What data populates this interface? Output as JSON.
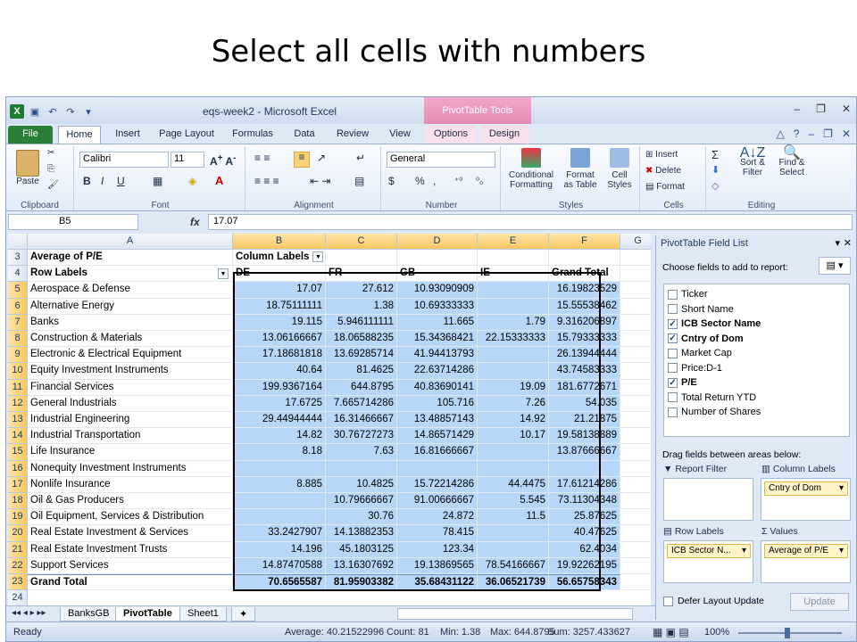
{
  "slide_title": "Select all cells with numbers",
  "window": {
    "title": "eqs-week2 - Microsoft Excel",
    "contextual_tab_group": "PivotTable Tools"
  },
  "tabs": [
    "File",
    "Home",
    "Insert",
    "Page Layout",
    "Formulas",
    "Data",
    "Review",
    "View",
    "Options",
    "Design"
  ],
  "ribbon": {
    "clipboard": {
      "paste": "Paste",
      "label": "Clipboard"
    },
    "font": {
      "name": "Calibri",
      "size": "11",
      "label": "Font"
    },
    "alignment": {
      "label": "Alignment"
    },
    "number": {
      "format": "General",
      "label": "Number",
      "percent": "%"
    },
    "styles": {
      "conditional": "Conditional",
      "conditional2": "Formatting",
      "format_table": "Format",
      "format_table2": "as Table",
      "cell_styles": "Cell",
      "cell_styles2": "Styles",
      "label": "Styles"
    },
    "cells": {
      "insert": "Insert",
      "delete": "Delete",
      "format": "Format",
      "label": "Cells"
    },
    "editing": {
      "sort": "Sort &",
      "sort2": "Filter",
      "find": "Find &",
      "find2": "Select",
      "label": "Editing"
    }
  },
  "formula_bar": {
    "name_box": "B5",
    "fx": "fx",
    "value": "17.07"
  },
  "columns": [
    "A",
    "B",
    "C",
    "D",
    "E",
    "F",
    "G"
  ],
  "pivot": {
    "title": "Average of P/E",
    "column_labels": "Column Labels",
    "row_labels": "Row Labels",
    "headers": [
      "DE",
      "FR",
      "GB",
      "IE",
      "Grand Total"
    ],
    "rows": [
      {
        "r": "5",
        "label": "Aerospace & Defense",
        "v": [
          "17.07",
          "27.612",
          "10.93090909",
          "",
          "16.19823529"
        ]
      },
      {
        "r": "6",
        "label": "Alternative Energy",
        "v": [
          "18.75111111",
          "1.38",
          "10.69333333",
          "",
          "15.55538462"
        ]
      },
      {
        "r": "7",
        "label": "Banks",
        "v": [
          "19.115",
          "5.946111111",
          "11.665",
          "1.79",
          "9.316206897"
        ]
      },
      {
        "r": "8",
        "label": "Construction & Materials",
        "v": [
          "13.06166667",
          "18.06588235",
          "15.34368421",
          "22.15333333",
          "15.79333333"
        ]
      },
      {
        "r": "9",
        "label": "Electronic & Electrical Equipment",
        "v": [
          "17.18681818",
          "13.69285714",
          "41.94413793",
          "",
          "26.13944444"
        ]
      },
      {
        "r": "10",
        "label": "Equity Investment Instruments",
        "v": [
          "40.64",
          "81.4625",
          "22.63714286",
          "",
          "43.74583333"
        ]
      },
      {
        "r": "11",
        "label": "Financial Services",
        "v": [
          "199.9367164",
          "644.8795",
          "40.83690141",
          "19.09",
          "181.6772671"
        ]
      },
      {
        "r": "12",
        "label": "General Industrials",
        "v": [
          "17.6725",
          "7.665714286",
          "105.716",
          "7.26",
          "54.035"
        ]
      },
      {
        "r": "13",
        "label": "Industrial Engineering",
        "v": [
          "29.44944444",
          "16.31466667",
          "13.48857143",
          "14.92",
          "21.21875"
        ]
      },
      {
        "r": "14",
        "label": "Industrial Transportation",
        "v": [
          "14.82",
          "30.76727273",
          "14.86571429",
          "10.17",
          "19.58138889"
        ]
      },
      {
        "r": "15",
        "label": "Life Insurance",
        "v": [
          "8.18",
          "7.63",
          "16.81666667",
          "",
          "13.87666667"
        ]
      },
      {
        "r": "16",
        "label": "Nonequity Investment Instruments",
        "v": [
          "",
          "",
          "",
          "",
          ""
        ]
      },
      {
        "r": "17",
        "label": "Nonlife Insurance",
        "v": [
          "8.885",
          "10.4825",
          "15.72214286",
          "44.4475",
          "17.61214286"
        ]
      },
      {
        "r": "18",
        "label": "Oil & Gas Producers",
        "v": [
          "",
          "10.79666667",
          "91.00666667",
          "5.545",
          "73.11304348"
        ]
      },
      {
        "r": "19",
        "label": "Oil Equipment, Services & Distribution",
        "v": [
          "",
          "30.76",
          "24.872",
          "11.5",
          "25.87625"
        ]
      },
      {
        "r": "20",
        "label": "Real Estate Investment & Services",
        "v": [
          "33.2427907",
          "14.13882353",
          "78.415",
          "",
          "40.47625"
        ]
      },
      {
        "r": "21",
        "label": "Real Estate Investment Trusts",
        "v": [
          "14.196",
          "45.1803125",
          "123.34",
          "",
          "62.4034"
        ]
      },
      {
        "r": "22",
        "label": "Support Services",
        "v": [
          "14.87470588",
          "13.16307692",
          "19.13869565",
          "78.54166667",
          "19.92262195"
        ]
      }
    ],
    "total": {
      "r": "23",
      "label": "Grand Total",
      "v": [
        "70.6565587",
        "81.95903382",
        "35.68431122",
        "36.06521739",
        "56.65758343"
      ]
    }
  },
  "row_numbers": {
    "r3": "3",
    "r4": "4",
    "r24": "24"
  },
  "sheet_tabs": [
    "BanksGB",
    "PivotTable",
    "Sheet1"
  ],
  "status": {
    "ready": "Ready",
    "average": "Average: 40.21522996",
    "count": "Count: 81",
    "min": "Min: 1.38",
    "max": "Max: 644.8795",
    "sum": "Sum: 3257.433627",
    "zoom": "100%"
  },
  "field_list": {
    "title": "PivotTable Field List",
    "choose": "Choose fields to add to report:",
    "fields": [
      {
        "name": "Ticker",
        "checked": false
      },
      {
        "name": "Short Name",
        "checked": false
      },
      {
        "name": "ICB Sector Name",
        "checked": true
      },
      {
        "name": "Cntry of Dom",
        "checked": true
      },
      {
        "name": "Market Cap",
        "checked": false
      },
      {
        "name": "Price:D-1",
        "checked": false
      },
      {
        "name": "P/E",
        "checked": true
      },
      {
        "name": "Total Return YTD",
        "checked": false
      },
      {
        "name": "Number of Shares",
        "checked": false
      }
    ],
    "drag_label": "Drag fields between areas below:",
    "report_filter": "Report Filter",
    "column_labels": "Column Labels",
    "row_labels": "Row Labels",
    "values": "Values",
    "col_chip": "Cntry of Dom",
    "row_chip": "ICB Sector N...",
    "val_chip": "Average of P/E",
    "defer": "Defer Layout Update",
    "update": "Update"
  }
}
